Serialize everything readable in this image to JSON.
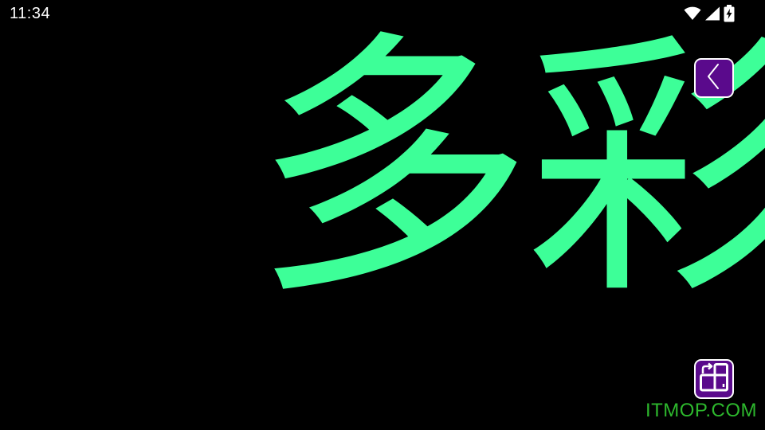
{
  "status_bar": {
    "time": "11:34",
    "icons": [
      "wifi-icon",
      "cellular-signal-icon",
      "battery-charging-icon"
    ]
  },
  "marquee": {
    "text": "多彩",
    "text_color": "#3dff98",
    "background_color": "#000000"
  },
  "controls": {
    "back_icon": "chevron-left-icon",
    "rotate_icon": "rotate-screen-icon",
    "button_color": "#5a0a8c"
  },
  "watermark": {
    "text": "ITMOP.COM",
    "color": "#2db82d"
  }
}
